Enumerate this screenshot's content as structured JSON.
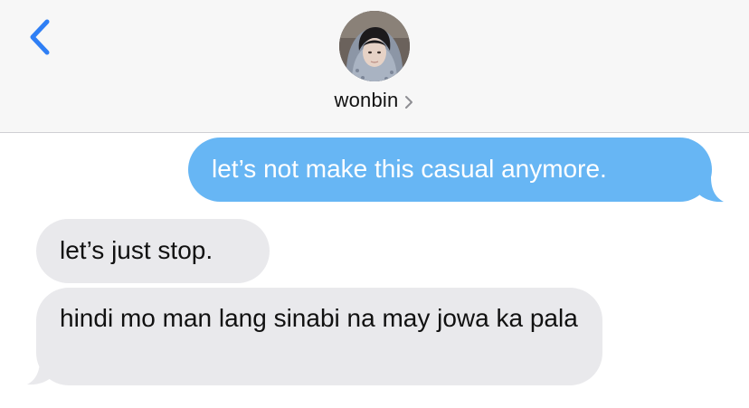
{
  "contact": {
    "name": "wonbin"
  },
  "colors": {
    "accent": "#2f7ff5",
    "sent_bubble": "#67b6f4",
    "received_bubble": "#e9e9ec",
    "header_bg": "#f7f7f7"
  },
  "icons": {
    "back": "chevron-left-icon",
    "contact_details": "chevron-right-icon",
    "avatar": "avatar"
  },
  "messages": [
    {
      "direction": "sent",
      "text": "let’s not make this casual anymore."
    },
    {
      "direction": "received",
      "text": "let’s just stop."
    },
    {
      "direction": "received",
      "text": "hindi mo man lang sinabi na may jowa ka pala"
    }
  ]
}
